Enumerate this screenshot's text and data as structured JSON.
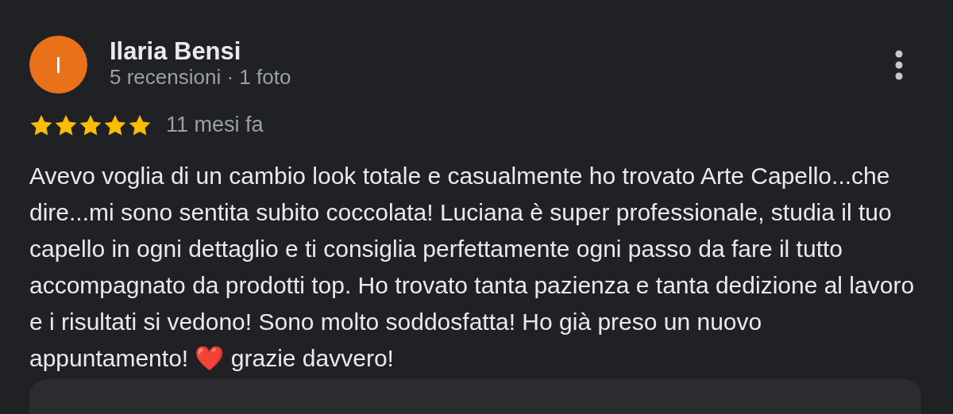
{
  "review": {
    "avatar_letter": "I",
    "author": "Ilaria Bensi",
    "meta": "5 recensioni · 1 foto",
    "stars": 5,
    "time": "11 mesi fa",
    "text": "Avevo voglia di un cambio look totale e casualmente ho trovato Arte Capello...che dire...mi sono sentita subito coccolata! Luciana è super professionale, studia il tuo capello in ogni dettaglio e ti consiglia perfettamente ogni passo da fare il tutto accompagnato da prodotti top. Ho trovato tanta pazienza e tanta dedizione al lavoro e i risultati si vedono! Sono molto soddosfatta! Ho già preso un nuovo appuntamento! ❤️ grazie davvero!"
  }
}
